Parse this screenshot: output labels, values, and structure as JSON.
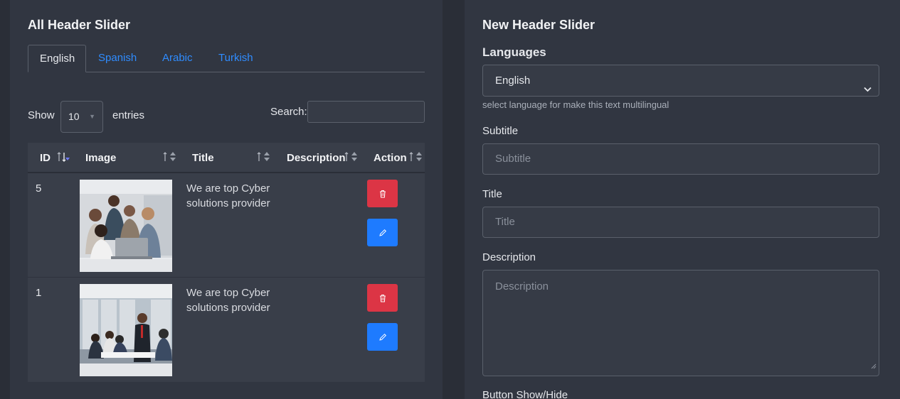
{
  "list_card": {
    "title": "All Header Slider",
    "tabs": [
      {
        "label": "English"
      },
      {
        "label": "Spanish"
      },
      {
        "label": "Arabic"
      },
      {
        "label": "Turkish"
      }
    ],
    "show_label": "Show",
    "entries_value": "10",
    "entries_label": "entries",
    "search_label": "Search:",
    "search_value": "",
    "columns": [
      "ID",
      "Image",
      "Title",
      "Description",
      "Action"
    ],
    "rows": [
      {
        "id": "5",
        "title": "We are top Cyber solutions provider",
        "description": ""
      },
      {
        "id": "1",
        "title": "We are top Cyber solutions provider",
        "description": ""
      }
    ]
  },
  "form_card": {
    "title": "New Header Slider",
    "languages_label": "Languages",
    "language_value": "English",
    "language_help": "select language for make this text multilingual",
    "subtitle_label": "Subtitle",
    "subtitle_placeholder": "Subtitle",
    "title_label": "Title",
    "title_placeholder": "Title",
    "description_label": "Description",
    "description_placeholder": "Description",
    "button_label": "Button Show/Hide"
  },
  "colors": {
    "page_bg": "#2a2e37",
    "card_bg": "#313641",
    "link": "#2f8cff",
    "danger": "#dc3545",
    "primary": "#1e7bff"
  },
  "icons": [
    "trash-icon",
    "pencil-icon",
    "sort-icon",
    "chevron-down-icon",
    "resize-handle-icon"
  ]
}
